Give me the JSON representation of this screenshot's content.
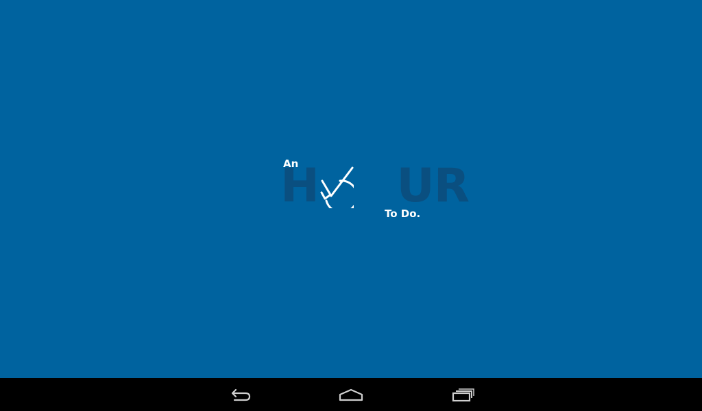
{
  "app": {
    "logo": {
      "prefix": "An",
      "word_left": "H",
      "word_right": "UR",
      "suffix": "To Do."
    }
  },
  "colors": {
    "background": "#00639f",
    "logo_word": "#0a4f80",
    "logo_accent": "#ffffff",
    "navbar": "#000000"
  },
  "navbar": {
    "buttons": [
      {
        "icon": "back-icon"
      },
      {
        "icon": "home-icon"
      },
      {
        "icon": "recents-icon"
      }
    ]
  }
}
